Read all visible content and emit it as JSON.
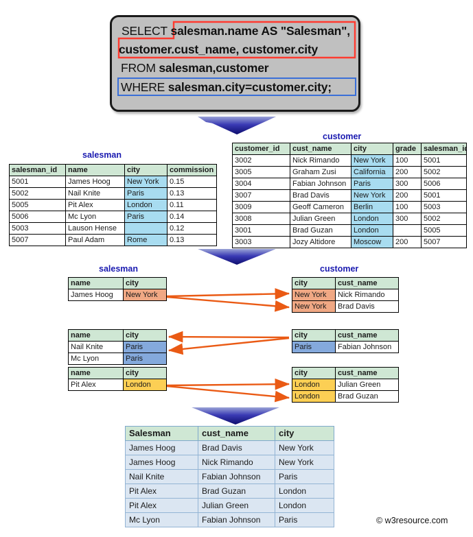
{
  "query": {
    "line1_keyword": "SELECT",
    "line1_rest": " salesman.name AS \"Salesman\",",
    "line2": "customer.cust_name, customer.city",
    "line3_keyword": "FROM",
    "line3_rest": " salesman,customer",
    "line4_keyword": "WHERE",
    "line4_rest": " salesman.city=customer.city;",
    "select_highlight_color": "#ff3b30",
    "where_highlight_color": "#3a6fd8"
  },
  "colors": {
    "header_green": "#cfe7d4",
    "city_blue": "#a8dcf0",
    "newyork_orange": "#f0a884",
    "paris_blue": "#84a9dc",
    "london_gold": "#fccf54",
    "result_row_blue": "#dbe6f2",
    "caption_blue": "#1a1ab0",
    "arrow_orange": "#ea5a14",
    "chevron_blue": "#1a1a9e"
  },
  "salesman_table": {
    "caption": "salesman",
    "columns": [
      "salesman_id",
      "name",
      "city",
      "commission"
    ],
    "rows": [
      {
        "salesman_id": "5001",
        "name": "James Hoog",
        "city": "New York",
        "commission": "0.15"
      },
      {
        "salesman_id": "5002",
        "name": "Nail Knite",
        "city": "Paris",
        "commission": "0.13"
      },
      {
        "salesman_id": "5005",
        "name": "Pit Alex",
        "city": "London",
        "commission": "0.11"
      },
      {
        "salesman_id": "5006",
        "name": "Mc Lyon",
        "city": "Paris",
        "commission": "0.14"
      },
      {
        "salesman_id": "5003",
        "name": "Lauson Hense",
        "city": "",
        "commission": "0.12"
      },
      {
        "salesman_id": "5007",
        "name": "Paul Adam",
        "city": "Rome",
        "commission": "0.13"
      }
    ]
  },
  "customer_table": {
    "caption": "customer",
    "columns": [
      "customer_id",
      "cust_name",
      "city",
      "grade",
      "salesman_id"
    ],
    "rows": [
      {
        "customer_id": "3002",
        "cust_name": "Nick Rimando",
        "city": "New York",
        "grade": "100",
        "salesman_id": "5001"
      },
      {
        "customer_id": "3005",
        "cust_name": "Graham Zusi",
        "city": "California",
        "grade": "200",
        "salesman_id": "5002"
      },
      {
        "customer_id": "3004",
        "cust_name": "Fabian Johnson",
        "city": "Paris",
        "grade": "300",
        "salesman_id": "5006"
      },
      {
        "customer_id": "3007",
        "cust_name": "Brad Davis",
        "city": "New York",
        "grade": "200",
        "salesman_id": "5001"
      },
      {
        "customer_id": "3009",
        "cust_name": "Geoff Cameron",
        "city": "Berlin",
        "grade": "100",
        "salesman_id": "5003"
      },
      {
        "customer_id": "3008",
        "cust_name": "Julian Green",
        "city": "London",
        "grade": "300",
        "salesman_id": "5002"
      },
      {
        "customer_id": "3001",
        "cust_name": "Brad Guzan",
        "city": "London",
        "grade": "",
        "salesman_id": "5005"
      },
      {
        "customer_id": "3003",
        "cust_name": "Jozy Altidore",
        "city": "Moscow",
        "grade": "200",
        "salesman_id": "5007"
      }
    ]
  },
  "match_section": {
    "left_caption": "salesman",
    "right_caption": "customer",
    "left_columns": [
      "name",
      "city"
    ],
    "right_columns": [
      "city",
      "cust_name"
    ],
    "groups": [
      {
        "key": "New York",
        "left_rows": [
          {
            "name": "James Hoog",
            "city": "New York"
          }
        ],
        "right_rows": [
          {
            "city": "New York",
            "cust_name": "Nick Rimando"
          },
          {
            "city": "New York",
            "cust_name": "Brad Davis"
          }
        ]
      },
      {
        "key": "Paris",
        "left_rows": [
          {
            "name": "Nail Knite",
            "city": "Paris"
          },
          {
            "name": "Mc Lyon",
            "city": "Paris"
          }
        ],
        "right_rows": [
          {
            "city": "Paris",
            "cust_name": "Fabian Johnson"
          }
        ]
      },
      {
        "key": "London",
        "left_rows": [
          {
            "name": "Pit Alex",
            "city": "London"
          }
        ],
        "right_rows": [
          {
            "city": "London",
            "cust_name": "Julian Green"
          },
          {
            "city": "London",
            "cust_name": "Brad Guzan"
          }
        ]
      }
    ]
  },
  "result_table": {
    "columns": [
      "Salesman",
      "cust_name",
      "city"
    ],
    "rows": [
      {
        "Salesman": "James Hoog",
        "cust_name": "Brad Davis",
        "city": "New York"
      },
      {
        "Salesman": "James Hoog",
        "cust_name": "Nick Rimando",
        "city": "New York"
      },
      {
        "Salesman": "Nail Knite",
        "cust_name": "Fabian Johnson",
        "city": "Paris"
      },
      {
        "Salesman": "Pit Alex",
        "cust_name": "Brad Guzan",
        "city": "London"
      },
      {
        "Salesman": "Pit Alex",
        "cust_name": "Julian Green",
        "city": "London"
      },
      {
        "Salesman": "Mc Lyon",
        "cust_name": "Fabian Johnson",
        "city": "Paris"
      }
    ]
  },
  "watermark": "© w3resource.com"
}
